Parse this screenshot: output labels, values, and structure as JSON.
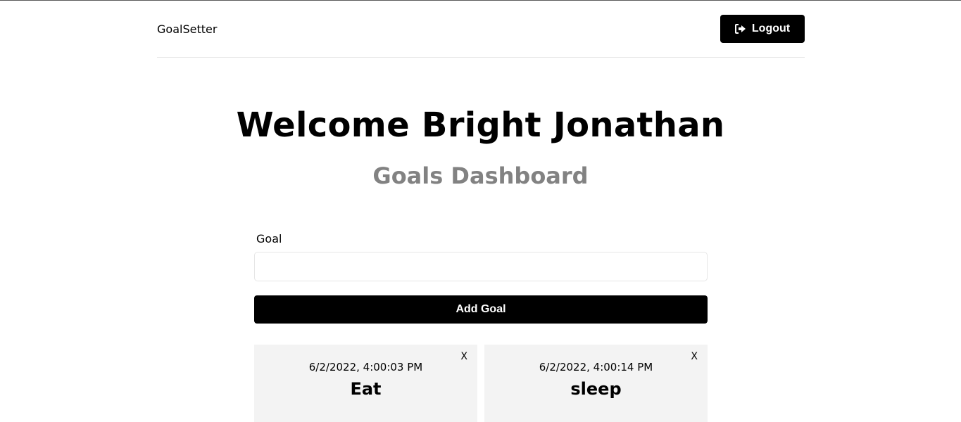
{
  "header": {
    "brand": "GoalSetter",
    "logout_label": "Logout",
    "logout_icon": "sign-out-icon"
  },
  "main": {
    "welcome": "Welcome Bright Jonathan",
    "subtitle": "Goals Dashboard"
  },
  "form": {
    "goal_label": "Goal",
    "goal_value": "",
    "add_button_label": "Add Goal"
  },
  "goals": [
    {
      "date": "6/2/2022, 4:00:03 PM",
      "text": "Eat",
      "close_label": "X"
    },
    {
      "date": "6/2/2022, 4:00:14 PM",
      "text": "sleep",
      "close_label": "X"
    }
  ],
  "colors": {
    "primary": "#000000",
    "subtitle": "#828282",
    "card_bg": "#f3f3f3",
    "divider": "#e6e6e6"
  }
}
